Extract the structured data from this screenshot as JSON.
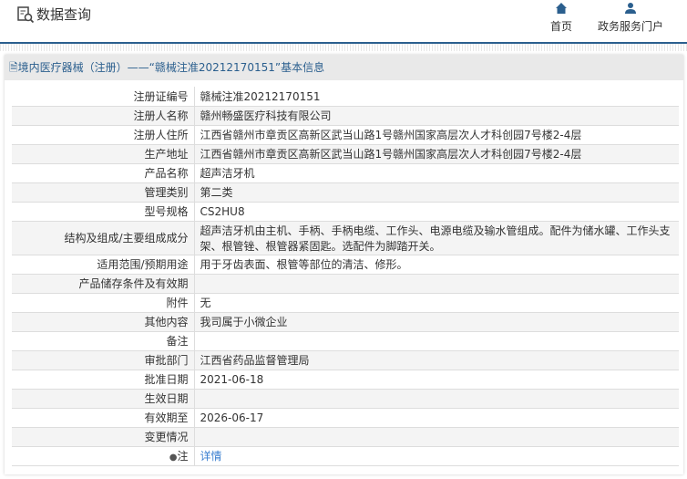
{
  "header": {
    "title": "数据查询",
    "nav": [
      {
        "label": "首页",
        "icon": "home-icon"
      },
      {
        "label": "政务服务门户",
        "icon": "user-icon"
      }
    ]
  },
  "panel": {
    "title": "境内医疗器械（注册）——“赣械注准20212170151”基本信息"
  },
  "rows": [
    {
      "label": "注册证编号",
      "value": "赣械注准20212170151"
    },
    {
      "label": "注册人名称",
      "value": "赣州畅盛医疗科技有限公司"
    },
    {
      "label": "注册人住所",
      "value": "江西省赣州市章贡区高新区武当山路1号赣州国家高层次人才科创园7号楼2-4层"
    },
    {
      "label": "生产地址",
      "value": "江西省赣州市章贡区高新区武当山路1号赣州国家高层次人才科创园7号楼2-4层"
    },
    {
      "label": "产品名称",
      "value": "超声洁牙机"
    },
    {
      "label": "管理类别",
      "value": "第二类"
    },
    {
      "label": "型号规格",
      "value": "CS2HU8"
    },
    {
      "label": "结构及组成/主要组成成分",
      "value": "超声洁牙机由主机、手柄、手柄电缆、工作头、电源电缆及输水管组成。配件为储水罐、工作头支架、根管锉、根管器紧固匙。选配件为脚踏开关。"
    },
    {
      "label": "适用范围/预期用途",
      "value": "用于牙齿表面、根管等部位的清洁、修形。"
    },
    {
      "label": "产品储存条件及有效期",
      "value": ""
    },
    {
      "label": "附件",
      "value": "无"
    },
    {
      "label": "其他内容",
      "value": "我司属于小微企业"
    },
    {
      "label": "备注",
      "value": ""
    },
    {
      "label": "审批部门",
      "value": "江西省药品监督管理局"
    },
    {
      "label": "批准日期",
      "value": "2021-06-18"
    },
    {
      "label": "生效日期",
      "value": ""
    },
    {
      "label": "有效期至",
      "value": "2026-06-17"
    },
    {
      "label": "变更情况",
      "value": ""
    },
    {
      "label": "注",
      "value": "详情"
    }
  ],
  "colors": {
    "accent": "#2b5f8e",
    "link": "#3a7fd0"
  }
}
